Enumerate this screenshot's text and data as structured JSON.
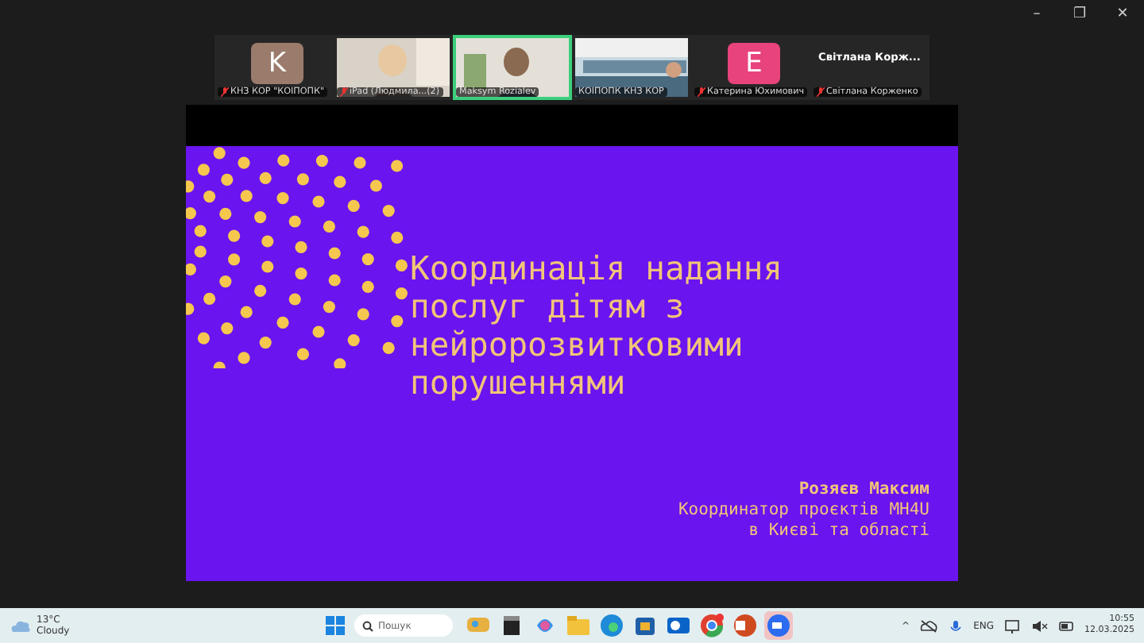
{
  "window": {
    "controls": [
      "–",
      "❐",
      "✕"
    ]
  },
  "participants": [
    {
      "kind": "avatar",
      "initial": "K",
      "color": "#9b7b6b",
      "name": "КНЗ КОР \"КОІПОПК\"",
      "muted": true,
      "speaking": false
    },
    {
      "kind": "video",
      "name": "iPad (Людмила...(2)",
      "muted": true,
      "speaking": false
    },
    {
      "kind": "video",
      "name": "Maksym Rozialev",
      "muted": false,
      "speaking": true
    },
    {
      "kind": "video",
      "name": "КОІПОПК КНЗ КОР",
      "muted": false,
      "speaking": false
    },
    {
      "kind": "avatar",
      "initial": "E",
      "color": "#e8437c",
      "name": "Катерина Юхимович",
      "muted": true,
      "speaking": false
    },
    {
      "kind": "name",
      "display": "Світлана Корж...",
      "name": "Світлана Корженко",
      "muted": true,
      "speaking": false
    }
  ],
  "slide": {
    "title": "Координація надання послуг дітям з нейророзвитковими порушеннями",
    "author": "Розяєв Максим",
    "role": "Координатор проєктів MH4U",
    "region": "в Києві та області"
  },
  "taskbar": {
    "weather": {
      "temp": "13°C",
      "condition": "Cloudy"
    },
    "search": {
      "placeholder": "Пошук"
    },
    "apps": [
      {
        "kind": "widget",
        "selected": false
      },
      {
        "kind": "taskview",
        "selected": false
      },
      {
        "kind": "copilot",
        "selected": false
      },
      {
        "kind": "folder",
        "selected": false
      },
      {
        "kind": "edge",
        "selected": false
      },
      {
        "kind": "store",
        "selected": false
      },
      {
        "kind": "outlook",
        "selected": false
      },
      {
        "kind": "chrome",
        "selected": false
      },
      {
        "kind": "powerpoint",
        "selected": false
      },
      {
        "kind": "zoom",
        "selected": true
      }
    ],
    "tray": {
      "caret": "^",
      "language": "ENG",
      "time": "10:55",
      "date": "12.03.2025"
    }
  }
}
